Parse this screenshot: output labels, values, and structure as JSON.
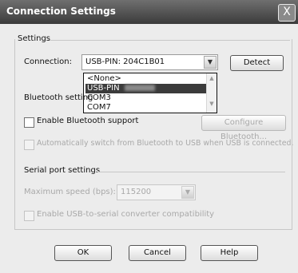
{
  "window": {
    "title": "Connection Settings",
    "close_glyph": "X"
  },
  "settings_group": {
    "label": "Settings",
    "connection_label": "Connection:",
    "connection_value": "USB-PIN: 204C1B01",
    "detect_label": "Detect",
    "dropdown_options": [
      "<None>",
      "USB-PIN",
      "COM3",
      "COM7"
    ],
    "selected_option_index": 1
  },
  "bluetooth": {
    "section_label": "Bluetooth setting",
    "enable_label": "Enable Bluetooth support",
    "configure_label": "Configure Bluetooth...",
    "auto_switch_label": "Automatically switch from Bluetooth to USB when USB is connected."
  },
  "serial": {
    "section_label": "Serial port settings",
    "speed_label": "Maximum speed (bps):",
    "speed_value": "115200",
    "usb_compat_label": "Enable USB-to-serial converter compatibility"
  },
  "buttons": {
    "ok": "OK",
    "cancel": "Cancel",
    "help": "Help"
  },
  "icons": {
    "dropdown": "chevron-down-icon",
    "scroll_up": "chevron-up-icon",
    "scroll_down": "chevron-down-icon"
  }
}
